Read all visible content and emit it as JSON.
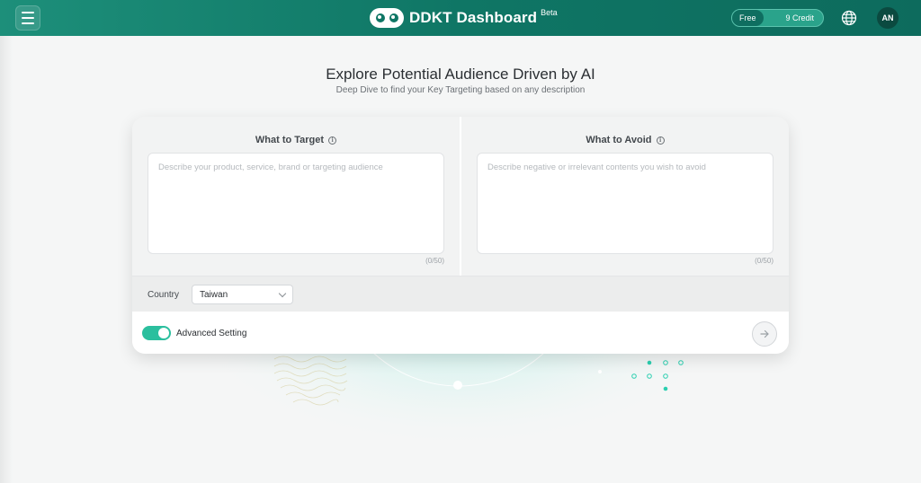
{
  "header": {
    "brand_name": "DDKT Dashboard",
    "brand_badge": "Beta",
    "plan_label": "Free",
    "credit_label": "9 Credit",
    "avatar_initials": "AN"
  },
  "hero": {
    "title": "Explore Potential Audience Driven by AI",
    "subtitle": "Deep Dive to find your Key Targeting based on any description"
  },
  "target": {
    "label": "What to Target",
    "placeholder": "Describe your product, service, brand or targeting audience",
    "value": "",
    "counter": "(0/50)"
  },
  "avoid": {
    "label": "What to Avoid",
    "placeholder": "Describe negative or irrelevant contents you wish to avoid",
    "value": "",
    "counter": "(0/50)"
  },
  "country": {
    "label": "Country",
    "selected": "Taiwan"
  },
  "advanced": {
    "label": "Advanced Setting",
    "enabled": true
  },
  "icons": {
    "menu": "menu-icon",
    "globe": "globe-icon",
    "info": "info-icon",
    "submit": "arrow-right-icon"
  },
  "colors": {
    "header_start": "#1d8f7a",
    "header_end": "#0d6b5d",
    "accent": "#2bbf9e"
  }
}
